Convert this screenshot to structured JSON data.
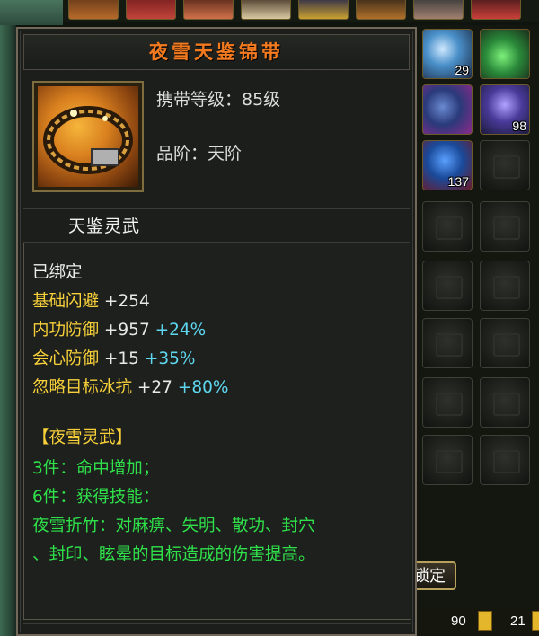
{
  "tooltip": {
    "title": "夜雪天鉴锦带",
    "level_label": "携带等级：85级",
    "grade_label": "品阶：天阶",
    "set_name": "天鉴灵武",
    "bind_status": "已绑定",
    "stats": [
      {
        "name": "基础闪避",
        "value": "+254",
        "percent": ""
      },
      {
        "name": "内功防御",
        "value": "+957",
        "percent": "+24%"
      },
      {
        "name": "会心防御",
        "value": "+15",
        "percent": "+35%"
      },
      {
        "name": "忽略目标冰抗",
        "value": "+27",
        "percent": "+80%"
      }
    ],
    "set_bonus_title": "【夜雪灵武】",
    "set_bonus_lines": [
      "3件：命中增加；",
      "6件：获得技能：",
      "夜雪折竹：对麻痹、失明、散功、封穴",
      "、封印、眩晕的目标造成的伤害提高。"
    ]
  },
  "inventory": {
    "counts": [
      "29",
      "98",
      "137"
    ],
    "lock_button": "锁定"
  },
  "bottom_bar": {
    "left_value": "90",
    "right_value": "21"
  }
}
